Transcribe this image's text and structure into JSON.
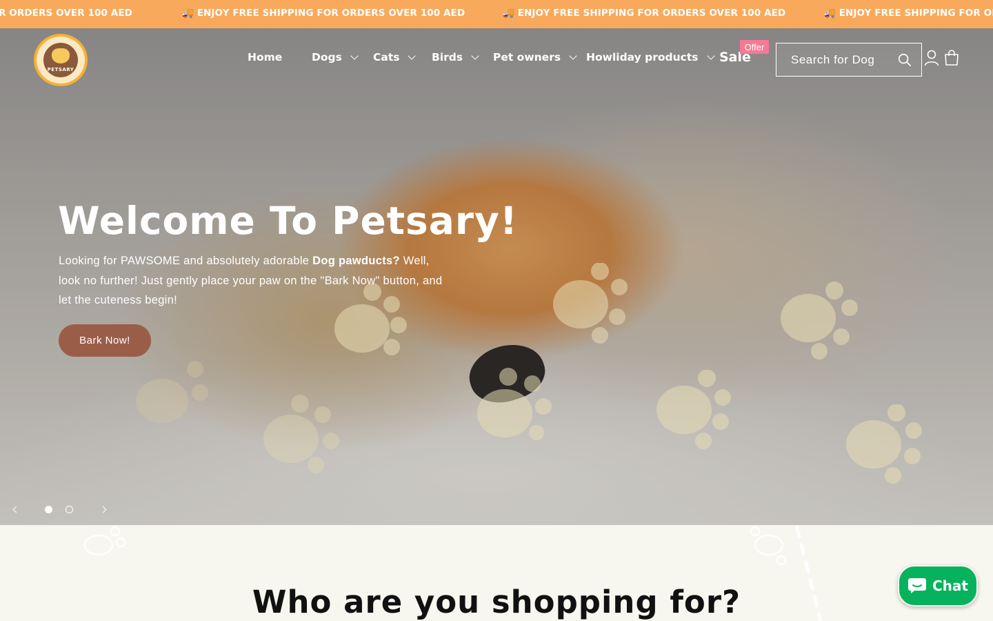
{
  "announcement": {
    "messages": [
      "ENJOY FREE SHIPPING FOR ORDERS OVER 100 AED",
      "🚚 ENJOY FREE SHIPPING FOR ORDERS OVER 100 AED",
      "🚚 ENJOY FREE SHIPPING FOR ORDERS OVER 100 AED",
      "🚚 ENJOY FREE SHIPPING FOR ORDE"
    ],
    "first_fragment": "R ORDERS OVER 100 AED"
  },
  "header": {
    "logo_text": "PETSARY",
    "nav": [
      {
        "label": "Home",
        "has_dropdown": false
      },
      {
        "label": "Dogs",
        "has_dropdown": true
      },
      {
        "label": "Cats",
        "has_dropdown": true
      },
      {
        "label": "Birds",
        "has_dropdown": true
      },
      {
        "label": "Pet owners",
        "has_dropdown": true
      },
      {
        "label": "Howliday products",
        "has_dropdown": true
      }
    ],
    "sale_label": "Sale",
    "offer_badge": "Offer",
    "search_placeholder": "Search for Dog",
    "icons": [
      "search-icon",
      "account-icon",
      "cart-icon"
    ]
  },
  "hero": {
    "title": "Welcome To Petsary!",
    "description_before": "Looking for PAWSOME and absolutely adorable ",
    "description_bold": "Dog pawducts?",
    "description_after": " Well, look no further! Just gently place your paw on the \"Bark Now\" button, and let the cuteness begin!",
    "cta_label": "Bark Now!",
    "slides_total": 2,
    "active_slide": 1
  },
  "section": {
    "title": "Who are you shopping for?"
  },
  "chat": {
    "label": "Chat"
  },
  "colors": {
    "announcement_bg": "#f9a95c",
    "cta_bg": "#9a5e48",
    "offer_badge": "#f57a95",
    "chat_bg": "#07b25d",
    "page_bg": "#f7f7ef"
  }
}
